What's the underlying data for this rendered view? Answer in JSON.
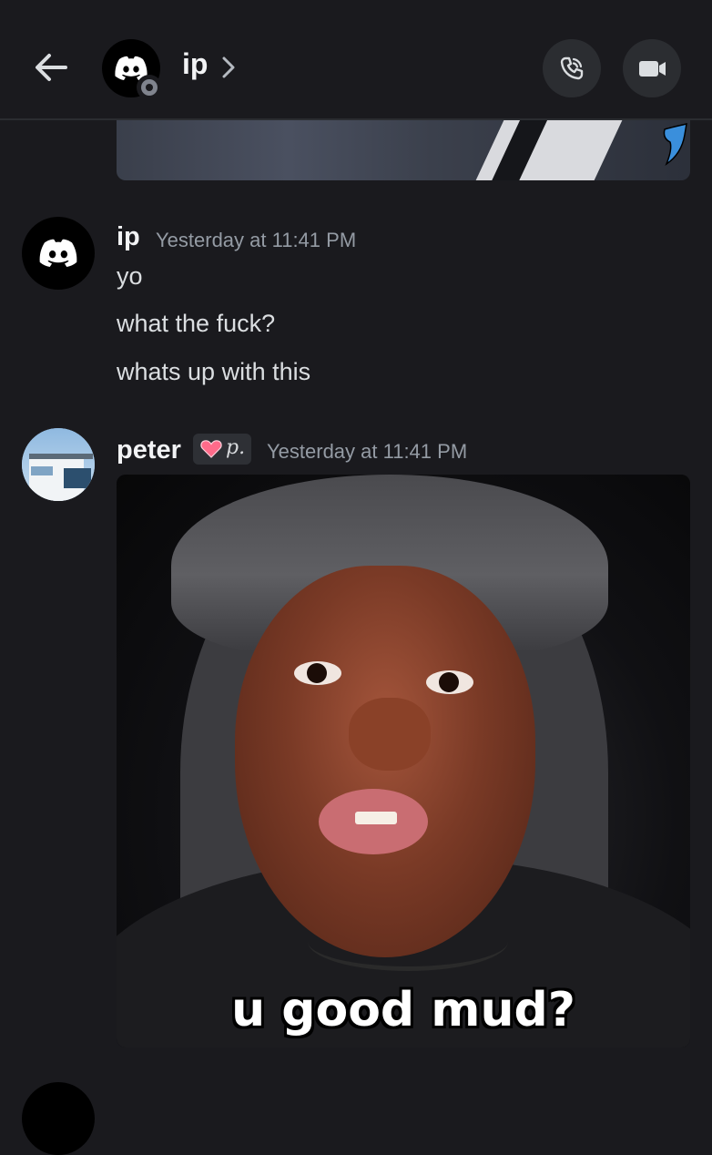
{
  "header": {
    "channel_name": "ip",
    "chevron": "chevron-right-icon",
    "back_icon": "arrow-left-icon",
    "call_icon": "phone-icon",
    "video_icon": "video-camera-icon",
    "status": "offline"
  },
  "messages": [
    {
      "author": "ip",
      "timestamp": "Yesterday at 11:41 PM",
      "lines": [
        "yo",
        "what the fuck?",
        "whats up with this"
      ]
    },
    {
      "author": "peter",
      "tag": "p.",
      "tag_icon": "heart-icon",
      "timestamp": "Yesterday at 11:41 PM",
      "image_caption": "u good mud?"
    }
  ],
  "colors": {
    "background": "#1a1a1e",
    "username": "#f2f3f5",
    "timestamp": "#949ba4",
    "text": "#dbdee1",
    "button_bg": "#2b2d31"
  }
}
